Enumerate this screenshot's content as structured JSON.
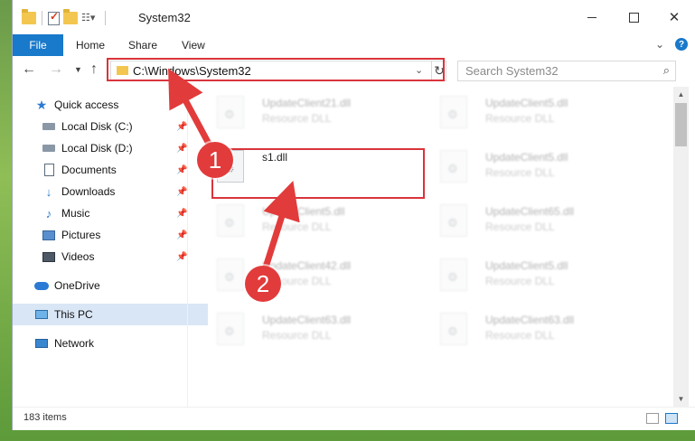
{
  "window": {
    "title": "System32"
  },
  "ribbon": {
    "tabs": [
      "File",
      "Home",
      "Share",
      "View"
    ]
  },
  "address": {
    "path": "C:\\Windows\\System32"
  },
  "search": {
    "placeholder": "Search System32"
  },
  "sidebar": {
    "items": [
      {
        "label": "Quick access",
        "icon": "star-icon"
      },
      {
        "label": "Local Disk (C:)",
        "icon": "drive-icon",
        "pinned": true
      },
      {
        "label": "Local Disk (D:)",
        "icon": "drive-icon",
        "pinned": true
      },
      {
        "label": "Documents",
        "icon": "document-icon",
        "pinned": true
      },
      {
        "label": "Downloads",
        "icon": "download-icon",
        "pinned": true
      },
      {
        "label": "Music",
        "icon": "music-icon",
        "pinned": true
      },
      {
        "label": "Pictures",
        "icon": "picture-icon",
        "pinned": true
      },
      {
        "label": "Videos",
        "icon": "video-icon",
        "pinned": true
      },
      {
        "label": "OneDrive",
        "icon": "cloud-icon"
      },
      {
        "label": "This PC",
        "icon": "computer-icon",
        "selected": true
      },
      {
        "label": "Network",
        "icon": "network-icon"
      }
    ]
  },
  "files": {
    "left": [
      {
        "name": "UpdateClient21.dll",
        "type": "Resource DLL"
      },
      {
        "name": "s1.dll",
        "type": ""
      },
      {
        "name": "UpdateClient5.dll",
        "type": "Resource DLL"
      },
      {
        "name": "UpdateClient42.dll",
        "type": "Resource DLL"
      },
      {
        "name": "UpdateClient63.dll",
        "type": "Resource DLL"
      }
    ],
    "right": [
      {
        "name": "UpdateClient5.dll",
        "type": "Resource DLL"
      },
      {
        "name": "UpdateClient5.dll",
        "type": "Resource DLL"
      },
      {
        "name": "UpdateClient65.dll",
        "type": "Resource DLL"
      },
      {
        "name": "UpdateClient5.dll",
        "type": "Resource DLL"
      },
      {
        "name": "UpdateClient63.dll",
        "type": "Resource DLL"
      }
    ]
  },
  "status": {
    "item_count": "183 items"
  },
  "annotations": {
    "step1": "1",
    "step2": "2",
    "color": "#e23b3b"
  }
}
